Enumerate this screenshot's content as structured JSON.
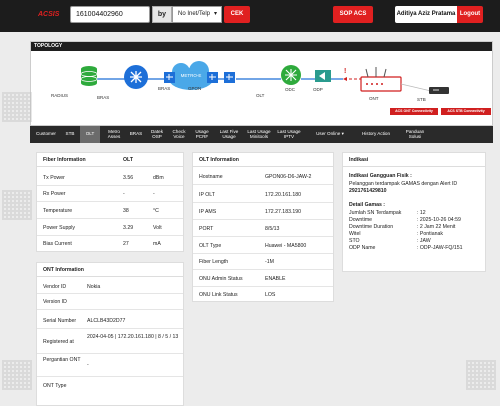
{
  "header": {
    "brand": "ACSIS",
    "search_value": "161004402960",
    "by_label": "by",
    "type_select": "No Inet/Telp",
    "check_label": "CEK",
    "sop_label": "SOP ACS",
    "user_name": "Aditiya Aziz Pratama",
    "logout_label": "Logout"
  },
  "topology": {
    "title": "TOPOLOGY",
    "nodes": {
      "radius": "RADIUS",
      "bras": "BRAS",
      "metro_e": "METRO-E",
      "bras_right": "BRAS",
      "gpon": "GPON",
      "olt": "OLT",
      "odc": "ODC",
      "odp": "ODP",
      "ont": "ONT",
      "stb": "STB"
    },
    "ont_status_badge": "ACS ONT Connectivity",
    "stb_status_badge": "ACS STB Connectivity"
  },
  "tabs": [
    {
      "label": "Customer"
    },
    {
      "label": "STB"
    },
    {
      "label": "OLT"
    },
    {
      "label": "Metro Asses"
    },
    {
      "label": "BRAS"
    },
    {
      "label": "Datek OSP"
    },
    {
      "label": "Check Voice"
    },
    {
      "label": "Usage PCRF"
    },
    {
      "label": "Last Five Usage"
    },
    {
      "label": "Last Usage Minitools"
    },
    {
      "label": "Last Usage IPTV"
    },
    {
      "label": "User Online ▾"
    },
    {
      "label": "History Action"
    },
    {
      "label": "Panduan Solusi"
    }
  ],
  "fiber_info": {
    "title": "Fiber Information",
    "col_header": "OLT",
    "rows": [
      {
        "label": "Tx Power",
        "value": "3.56",
        "unit": "dBm"
      },
      {
        "label": "Rx Power",
        "value": "-",
        "unit": "-"
      },
      {
        "label": "Temperature",
        "value": "38",
        "unit": "°C"
      },
      {
        "label": "Power Supply",
        "value": "3.29",
        "unit": "Volt"
      },
      {
        "label": "Bias Current",
        "value": "27",
        "unit": "mA"
      }
    ]
  },
  "ont_info": {
    "title": "ONT Information",
    "rows": [
      {
        "label": "Vendor ID",
        "value": "Nokia"
      },
      {
        "label": "Version ID",
        "value": ""
      },
      {
        "label": "Serial Number",
        "value": "ALCLB43D2D77"
      },
      {
        "label": "Registered at",
        "value": "2024-04-05 | 172.20.161.180 | 8 / 5 / 13"
      },
      {
        "label": "Pergantian ONT",
        "value": "-"
      },
      {
        "label": "ONT Type",
        "value": ""
      }
    ]
  },
  "olt_info": {
    "title": "OLT Information",
    "rows": [
      {
        "label": "Hostname",
        "value": "GPON06-D6-JAW-2"
      },
      {
        "label": "IP OLT",
        "value": "172.20.161.180"
      },
      {
        "label": "IP AMS",
        "value": "172.27.183.190"
      },
      {
        "label": "PORT",
        "value": "8/5/13"
      },
      {
        "label": "OLT Type",
        "value": "Huawei - MA5800"
      },
      {
        "label": "Fiber Length",
        "value": "-1M"
      },
      {
        "label": "ONU Admin Status",
        "value": "ENABLE"
      },
      {
        "label": "ONU Link Status",
        "value": "LOS"
      }
    ]
  },
  "indikasi": {
    "title": "Indikasi",
    "gangguan_title": "Indikasi Gangguan Fisik :",
    "gangguan_text": "Pelanggan terdampak GAMAS dengan Alert ID",
    "alert_id": "2921761429810",
    "gamas_title": "Detail Gamas :",
    "gamas": [
      {
        "label": "Jumlah SN Terdampak",
        "value": ": 12"
      },
      {
        "label": "Downtime",
        "value": ": 2025-10-26 04:59"
      },
      {
        "label": "Downtime Duration",
        "value": ": 2 Jam 22 Menit"
      },
      {
        "label": "Witel",
        "value": ": Pontianak"
      },
      {
        "label": "STO",
        "value": ": JAW"
      },
      {
        "label": "ODP Name",
        "value": ": ODP-JAW-FQ/151"
      }
    ]
  },
  "colors": {
    "accent": "#e02020",
    "topbar": "#1c1c1c",
    "node_blue": "#1d6fd8",
    "node_green": "#2eaa3c",
    "node_teal": "#2a9b8e"
  }
}
